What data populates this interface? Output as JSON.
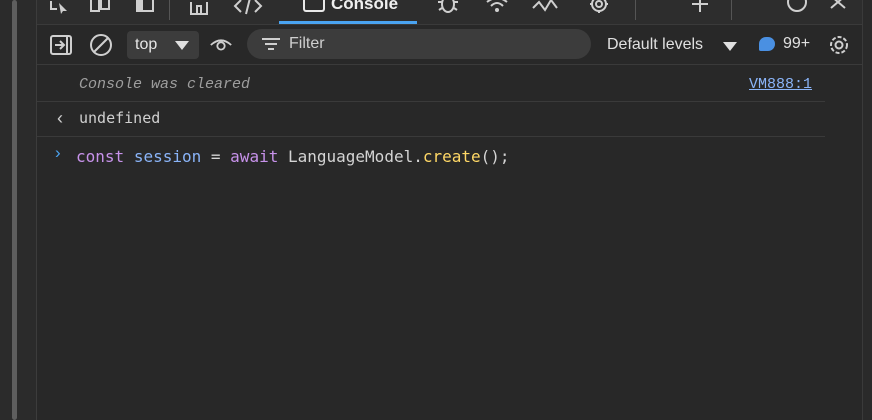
{
  "tabs": [
    {
      "name": "elements"
    },
    {
      "name": "console",
      "label": "Console",
      "active": true
    },
    {
      "name": "sources"
    }
  ],
  "toolbar": {
    "context": "top",
    "filter_placeholder": "Filter",
    "levels": "Default levels",
    "issues_count": "99+"
  },
  "console": {
    "cleared_text": "Console was cleared",
    "cleared_source": "VM888:1",
    "result_text": "undefined",
    "input": {
      "kw1": "const",
      "var": "session",
      "op": "=",
      "kw2": "await",
      "obj": "LanguageModel.",
      "fn": "create",
      "tail": "();"
    }
  },
  "colors": {
    "background": "#282828",
    "accent": "#4aa3f0",
    "keyword": "#c792ea",
    "variable": "#8ab4f8",
    "function": "#ffd866"
  },
  "icons": [
    "inspect-icon",
    "device-icon",
    "sidebar-icon",
    "home-icon",
    "code-icon",
    "console-icon",
    "bug-icon",
    "wifi-icon",
    "performance-icon",
    "settings-gear-icon",
    "plus-icon",
    "help-icon",
    "close-icon",
    "clear-console-icon",
    "no-entry-icon",
    "eye-icon",
    "filter-icon",
    "issues-icon",
    "gear-icon"
  ]
}
